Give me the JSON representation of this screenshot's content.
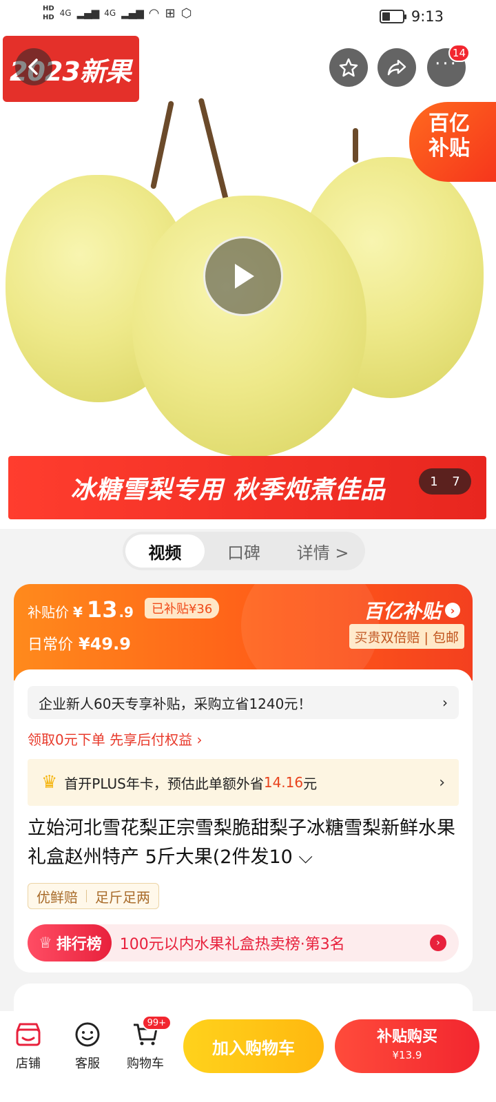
{
  "status_bar": {
    "hd1": "HD",
    "hd2": "HD",
    "net1": "4G",
    "net2": "4G",
    "time": "9:13"
  },
  "hero": {
    "new_badge": "2023新果",
    "more_badge": "14",
    "corner_line1": "百亿",
    "corner_line2": "补贴",
    "banner": "冰糖雪梨专用  秋季炖煮佳品",
    "page_current": "1",
    "page_total": "7"
  },
  "tabs": [
    {
      "label": "视频"
    },
    {
      "label": "口碑"
    },
    {
      "label": "详情 >"
    }
  ],
  "price": {
    "sub_label": "补贴价",
    "yen": "¥",
    "int": "13",
    "dec": ".9",
    "subsidy": "已补贴¥36",
    "daily_label": "日常价",
    "daily_value": "¥49.9",
    "brand": "百亿补贴",
    "guarantee": "买贵双倍赔 | 包邮"
  },
  "product": {
    "notice": "企业新人60天专享补贴，采购立省1240元！",
    "paylater": "领取0元下单 先享后付权益 ›",
    "plus_prefix": "首开PLUS年卡，预估此单额外省",
    "plus_save": "14.16",
    "plus_suffix": "元",
    "title": "立始河北雪花梨正宗雪梨脆甜梨子冰糖雪梨新鲜水果礼盒赵州特产 5斤大果(2件发10 ⌵",
    "tag1": "优鲜赔",
    "tag2": "足斤足两",
    "rank_label": "排行榜",
    "rank_text": "100元以内水果礼盒热卖榜·第3名"
  },
  "bottom_bar": {
    "shop": "店铺",
    "service": "客服",
    "cart": "购物车",
    "cart_badge": "99+",
    "add_cart": "加入购物车",
    "buy_now": "补贴购买",
    "buy_price": "¥13.9"
  },
  "colors": {
    "accent_red": "#f2262f",
    "subsidy_orange": "#ff5a18",
    "add_cart_yellow": "#ffc516"
  }
}
